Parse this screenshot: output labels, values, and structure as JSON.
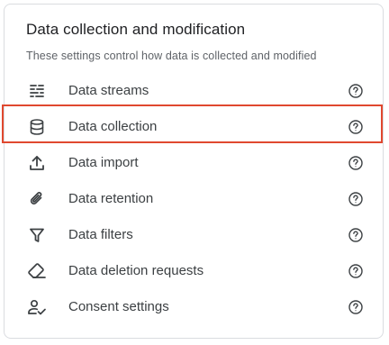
{
  "card": {
    "title": "Data collection and modification",
    "subtitle": "These settings control how data is collected and modified"
  },
  "items": [
    {
      "label": "Data streams",
      "icon": "data-streams-icon"
    },
    {
      "label": "Data collection",
      "icon": "database-icon",
      "highlighted": true
    },
    {
      "label": "Data import",
      "icon": "upload-icon"
    },
    {
      "label": "Data retention",
      "icon": "attachment-icon"
    },
    {
      "label": "Data filters",
      "icon": "filter-icon"
    },
    {
      "label": "Data deletion requests",
      "icon": "eraser-icon"
    },
    {
      "label": "Consent settings",
      "icon": "consent-user-check-icon"
    }
  ],
  "help_icon": "help-circle-icon",
  "colors": {
    "text": "#3c4043",
    "subtle": "#5f6368",
    "highlight_border": "#e0482f",
    "card_border": "#dadce0"
  }
}
